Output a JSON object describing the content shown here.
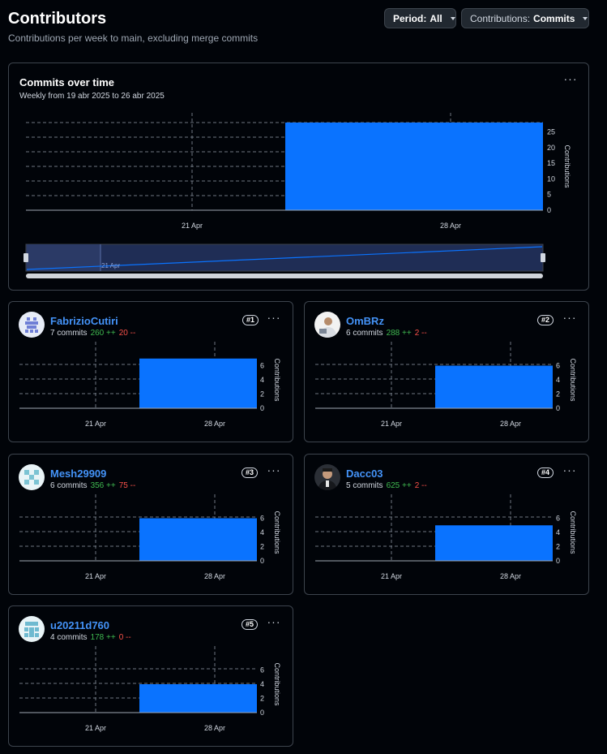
{
  "header": {
    "title": "Contributors",
    "subtitle": "Contributions per week to main, excluding merge commits",
    "period_label": "Period:",
    "period_value": "All",
    "contrib_label": "Contributions:",
    "contrib_value": "Commits"
  },
  "overview": {
    "title": "Commits over time",
    "subtitle": "Weekly from 19 abr 2025 to 26 abr 2025",
    "brush_label": "21 Apr"
  },
  "colors": {
    "bar": "#0a73ff",
    "add": "#3fb950",
    "del": "#f85149",
    "link": "#4493f8"
  },
  "chart_data": [
    {
      "type": "bar",
      "title": "Commits over time",
      "categories": [
        "21 Apr",
        "28 Apr"
      ],
      "x_ticks": [
        "21 Apr",
        "28 Apr"
      ],
      "ylabel": "Contributions",
      "y_ticks": [
        0,
        5,
        10,
        15,
        20,
        25
      ],
      "ylim": [
        0,
        28
      ],
      "values": [
        0,
        28
      ]
    },
    {
      "type": "bar",
      "title": "FabrizioCutiri",
      "categories": [
        "21 Apr",
        "28 Apr"
      ],
      "x_ticks": [
        "21 Apr",
        "28 Apr"
      ],
      "ylabel": "Contributions",
      "y_ticks": [
        0,
        2,
        4,
        6
      ],
      "ylim": [
        0,
        8
      ],
      "values": [
        0,
        7
      ]
    },
    {
      "type": "bar",
      "title": "OmBRz",
      "categories": [
        "21 Apr",
        "28 Apr"
      ],
      "x_ticks": [
        "21 Apr",
        "28 Apr"
      ],
      "ylabel": "Contributions",
      "y_ticks": [
        0,
        2,
        4,
        6
      ],
      "ylim": [
        0,
        8
      ],
      "values": [
        0,
        6
      ]
    },
    {
      "type": "bar",
      "title": "Mesh29909",
      "categories": [
        "21 Apr",
        "28 Apr"
      ],
      "x_ticks": [
        "21 Apr",
        "28 Apr"
      ],
      "ylabel": "Contributions",
      "y_ticks": [
        0,
        2,
        4,
        6
      ],
      "ylim": [
        0,
        8
      ],
      "values": [
        0,
        6
      ]
    },
    {
      "type": "bar",
      "title": "Dacc03",
      "categories": [
        "21 Apr",
        "28 Apr"
      ],
      "x_ticks": [
        "21 Apr",
        "28 Apr"
      ],
      "ylabel": "Contributions",
      "y_ticks": [
        0,
        2,
        4,
        6
      ],
      "ylim": [
        0,
        8
      ],
      "values": [
        0,
        5
      ]
    },
    {
      "type": "bar",
      "title": "u20211d760",
      "categories": [
        "21 Apr",
        "28 Apr"
      ],
      "x_ticks": [
        "21 Apr",
        "28 Apr"
      ],
      "ylabel": "Contributions",
      "y_ticks": [
        0,
        2,
        4,
        6
      ],
      "ylim": [
        0,
        8
      ],
      "values": [
        0,
        4
      ]
    }
  ],
  "contributors": [
    {
      "name": "FabrizioCutiri",
      "commits": "7 commits",
      "additions": "260 ++",
      "deletions": "20 --",
      "rank": "#1",
      "avatar": "identicon-blue"
    },
    {
      "name": "OmBRz",
      "commits": "6 commits",
      "additions": "288 ++",
      "deletions": "2 --",
      "rank": "#2",
      "avatar": "photo"
    },
    {
      "name": "Mesh29909",
      "commits": "6 commits",
      "additions": "356 ++",
      "deletions": "75 --",
      "rank": "#3",
      "avatar": "identicon-cyan"
    },
    {
      "name": "Dacc03",
      "commits": "5 commits",
      "additions": "625 ++",
      "deletions": "2 --",
      "rank": "#4",
      "avatar": "photo"
    },
    {
      "name": "u20211d760",
      "commits": "4 commits",
      "additions": "178 ++",
      "deletions": "0 --",
      "rank": "#5",
      "avatar": "identicon-cyan"
    }
  ]
}
